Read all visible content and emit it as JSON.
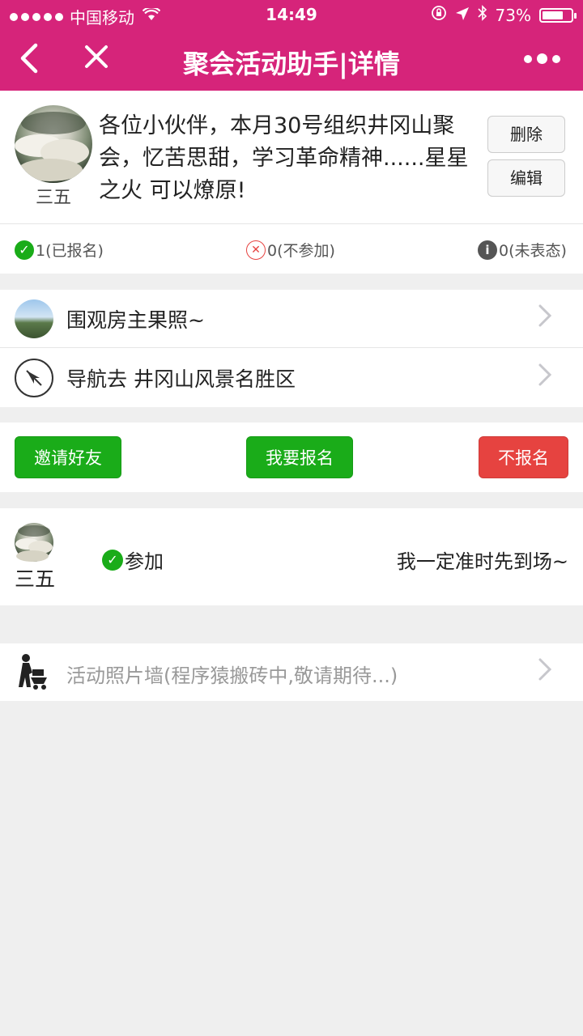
{
  "status_bar": {
    "carrier": "中国移动",
    "time": "14:49",
    "battery": "73%",
    "battery_level": 0.73
  },
  "nav": {
    "title": "聚会活动助手|详情",
    "back_icon": "chevron-left-icon",
    "close_icon": "close-icon",
    "more_icon": "more-icon"
  },
  "post": {
    "author": "三五",
    "content": "各位小伙伴，本月30号组织井冈山聚会，忆苦思甜，学习革命精神......星星之火 可以燎原!",
    "delete_label": "删除",
    "edit_label": "编辑"
  },
  "stats": {
    "signed": "1(已报名)",
    "declined": "0(不参加)",
    "undecided": "0(未表态)"
  },
  "list": {
    "photo_label": "围观房主果照~",
    "nav_label": "导航去 井冈山风景名胜区"
  },
  "actions": {
    "invite": "邀请好友",
    "signup": "我要报名",
    "decline": "不报名"
  },
  "participant": {
    "name": "三五",
    "status": "参加",
    "comment": "我一定准时先到场~"
  },
  "photo_wall": {
    "label": "活动照片墙(程序猿搬砖中,敬请期待...)"
  },
  "colors": {
    "brand": "#d6247a",
    "green": "#1aac19",
    "red": "#e64340"
  }
}
